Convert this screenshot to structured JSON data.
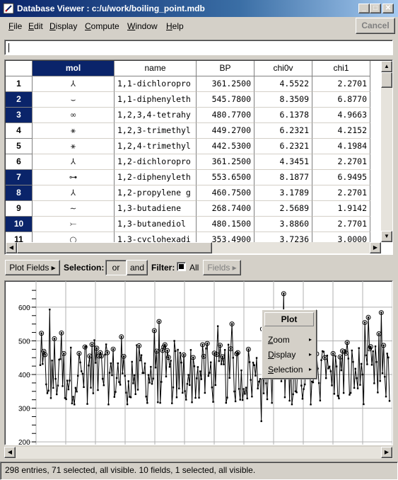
{
  "window": {
    "title": "Database Viewer : c:/u/work/boiling_point.mdb",
    "controls": [
      "_",
      "□",
      "✕"
    ]
  },
  "menubar": {
    "items": [
      {
        "label": "File",
        "key": "F",
        "rest": "ile"
      },
      {
        "label": "Edit",
        "key": "E",
        "rest": "dit"
      },
      {
        "label": "Display",
        "key": "D",
        "rest": "isplay"
      },
      {
        "label": "Compute",
        "key": "C",
        "rest": "ompute"
      },
      {
        "label": "Window",
        "key": "W",
        "rest": "indow"
      },
      {
        "label": "Help",
        "key": "H",
        "rest": "elp"
      }
    ],
    "cancel_label": "Cancel"
  },
  "command_input": {
    "value": ""
  },
  "table": {
    "columns": [
      "",
      "mol",
      "name",
      "BP",
      "chi0v",
      "chi1"
    ],
    "selected_column": "mol",
    "rows": [
      {
        "num": "1",
        "selected": false,
        "mol": "⅄",
        "name": "1,1-dichloropro",
        "BP": "361.2500",
        "chi0v": "4.5522",
        "chi1": "2.2701"
      },
      {
        "num": "2",
        "selected": true,
        "mol": "⌣",
        "name": "1,1-diphenyleth",
        "BP": "545.7800",
        "chi0v": "8.3509",
        "chi1": "6.8770"
      },
      {
        "num": "3",
        "selected": true,
        "mol": "∞",
        "name": "1,2,3,4-tetrahy",
        "BP": "480.7700",
        "chi0v": "6.1378",
        "chi1": "4.9663"
      },
      {
        "num": "4",
        "selected": false,
        "mol": "⚹",
        "name": "1,2,3-trimethyl",
        "BP": "449.2700",
        "chi0v": "6.2321",
        "chi1": "4.2152"
      },
      {
        "num": "5",
        "selected": false,
        "mol": "⚹",
        "name": "1,2,4-trimethyl",
        "BP": "442.5300",
        "chi0v": "6.2321",
        "chi1": "4.1984"
      },
      {
        "num": "6",
        "selected": false,
        "mol": "⅄",
        "name": "1,2-dichloropro",
        "BP": "361.2500",
        "chi0v": "4.3451",
        "chi1": "2.2701"
      },
      {
        "num": "7",
        "selected": true,
        "mol": "⊶",
        "name": "1,2-diphenyleth",
        "BP": "553.6500",
        "chi0v": "8.1877",
        "chi1": "6.9495"
      },
      {
        "num": "8",
        "selected": true,
        "mol": "⅄",
        "name": "1,2-propylene g",
        "BP": "460.7500",
        "chi0v": "3.1789",
        "chi1": "2.2701"
      },
      {
        "num": "9",
        "selected": false,
        "mol": "∼",
        "name": "1,3-butadiene",
        "BP": "268.7400",
        "chi0v": "2.5689",
        "chi1": "1.9142"
      },
      {
        "num": "10",
        "selected": true,
        "mol": "⤚",
        "name": "1,3-butanediol",
        "BP": "480.1500",
        "chi0v": "3.8860",
        "chi1": "2.7701"
      },
      {
        "num": "11",
        "selected": false,
        "mol": "○",
        "name": "1,3-cyclohexadi",
        "BP": "353.4900",
        "chi0v": "3.7236",
        "chi1": "3.0000"
      }
    ]
  },
  "toolbar": {
    "plot_fields": "Plot Fields ▸",
    "selection_label": "Selection:",
    "or_label": "or",
    "and_label": "and",
    "filter_label": "Filter:",
    "all_label": "All",
    "fields_label": "Fields ▸"
  },
  "plot": {
    "chart_data": {
      "type": "line",
      "yticks": [
        200,
        300,
        400,
        500,
        600
      ],
      "ylim": [
        175,
        665
      ],
      "xlim": [
        0,
        297
      ],
      "grid": true,
      "n_points": 298,
      "markers": "circles on selected entries"
    }
  },
  "context_menu": {
    "title": "Plot",
    "items": [
      {
        "label": "Zoom",
        "key": "Z",
        "rest": "oom",
        "arrow": "▸"
      },
      {
        "label": "Display",
        "key": "D",
        "rest": "isplay",
        "arrow": "▸"
      },
      {
        "label": "Selection",
        "key": "S",
        "rest": "election",
        "arrow": "▸"
      }
    ]
  },
  "status": {
    "text": "298 entries, 71 selected, all visible. 10 fields, 1 selected, all visible."
  },
  "colors": {
    "selection": "#0a246a",
    "face": "#d4d0c8"
  }
}
